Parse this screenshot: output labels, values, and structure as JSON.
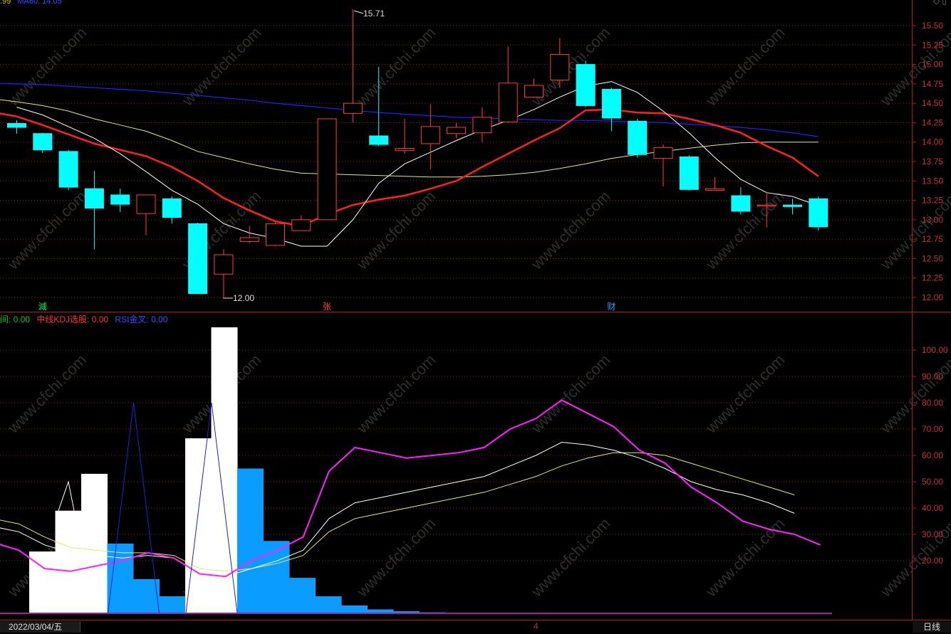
{
  "header": {
    "partial_left": ".99",
    "partial_ma": "MA60: 14.05"
  },
  "indicator_legend": [
    {
      "label": "间: 0.00",
      "color": "#00cc00"
    },
    {
      "label": "中线KDJ选股: 0.00",
      "color": "#ff3030"
    },
    {
      "label": "RSI金叉: 0.00",
      "color": "#3050ff"
    }
  ],
  "footer": {
    "date": "2022/03/04/五",
    "scroll_marker": "4",
    "period": "日线"
  },
  "price_annotations": {
    "high": "15.71",
    "low": "12.00"
  },
  "event_markers": [
    {
      "index": 1,
      "text": "減",
      "color": "#00ff60"
    },
    {
      "index": 12,
      "text": "张",
      "color": "#ff4040"
    },
    {
      "index": 23,
      "text": "财",
      "color": "#30a0ff"
    }
  ],
  "watermark": "www.cfchi.com",
  "colors": {
    "up": "#ff3b3b",
    "down": "#00ffff",
    "axis": "#b01818",
    "ma_white": "#ffffff",
    "ma_red": "#ff2020",
    "ma_yellow": "#e8e870",
    "ma_blue": "#2020ff",
    "bar_white": "#ffffff",
    "bar_blue": "#0a9cff",
    "line_magenta": "#ff20ff",
    "line_signal_blue": "#2020dd"
  },
  "chart_data": [
    {
      "type": "candlestick",
      "ylim": [
        11.9,
        15.75
      ],
      "ticks": [
        "15.50",
        "15.25",
        "15.00",
        "14.75",
        "14.50",
        "14.25",
        "14.00",
        "13.75",
        "13.50",
        "13.25",
        "13.00",
        "12.75",
        "12.50",
        "12.25",
        "12.00"
      ],
      "candles": [
        {
          "o": 14.24,
          "h": 14.28,
          "l": 14.11,
          "c": 14.19
        },
        {
          "o": 14.11,
          "h": 14.12,
          "l": 13.86,
          "c": 13.9
        },
        {
          "o": 13.88,
          "h": 13.9,
          "l": 13.38,
          "c": 13.42
        },
        {
          "o": 13.4,
          "h": 13.63,
          "l": 12.62,
          "c": 13.15
        },
        {
          "o": 13.32,
          "h": 13.4,
          "l": 13.1,
          "c": 13.2
        },
        {
          "o": 13.08,
          "h": 13.32,
          "l": 12.8,
          "c": 13.32
        },
        {
          "o": 13.27,
          "h": 13.3,
          "l": 12.95,
          "c": 13.03
        },
        {
          "o": 12.95,
          "h": 12.96,
          "l": 12.05,
          "c": 12.05
        },
        {
          "o": 12.3,
          "h": 12.62,
          "l": 12.0,
          "c": 12.55
        },
        {
          "o": 12.72,
          "h": 12.92,
          "l": 12.7,
          "c": 12.77
        },
        {
          "o": 12.67,
          "h": 12.97,
          "l": 12.66,
          "c": 12.95
        },
        {
          "o": 12.86,
          "h": 13.06,
          "l": 12.86,
          "c": 13.0
        },
        {
          "o": 13.0,
          "h": 14.3,
          "l": 13.0,
          "c": 14.3
        },
        {
          "o": 14.37,
          "h": 15.71,
          "l": 14.25,
          "c": 14.5
        },
        {
          "o": 14.08,
          "h": 14.97,
          "l": 13.95,
          "c": 13.97
        },
        {
          "o": 13.89,
          "h": 14.3,
          "l": 13.85,
          "c": 13.92
        },
        {
          "o": 13.98,
          "h": 14.49,
          "l": 13.65,
          "c": 14.2
        },
        {
          "o": 14.11,
          "h": 14.25,
          "l": 14.05,
          "c": 14.19
        },
        {
          "o": 14.12,
          "h": 14.45,
          "l": 14.0,
          "c": 14.32
        },
        {
          "o": 14.26,
          "h": 15.23,
          "l": 14.25,
          "c": 14.76
        },
        {
          "o": 14.58,
          "h": 14.82,
          "l": 14.57,
          "c": 14.73
        },
        {
          "o": 14.8,
          "h": 15.34,
          "l": 14.7,
          "c": 15.13
        },
        {
          "o": 15.0,
          "h": 15.05,
          "l": 14.45,
          "c": 14.47
        },
        {
          "o": 14.68,
          "h": 14.7,
          "l": 14.14,
          "c": 14.31
        },
        {
          "o": 14.27,
          "h": 14.3,
          "l": 13.8,
          "c": 13.84
        },
        {
          "o": 13.79,
          "h": 13.97,
          "l": 13.43,
          "c": 13.93
        },
        {
          "o": 13.81,
          "h": 13.83,
          "l": 13.38,
          "c": 13.39
        },
        {
          "o": 13.38,
          "h": 13.55,
          "l": 13.38,
          "c": 13.4
        },
        {
          "o": 13.31,
          "h": 13.42,
          "l": 13.07,
          "c": 13.11
        },
        {
          "o": 13.19,
          "h": 13.36,
          "l": 12.9,
          "c": 13.19
        },
        {
          "o": 13.19,
          "h": 13.27,
          "l": 13.07,
          "c": 13.17
        },
        {
          "o": 13.27,
          "h": 13.3,
          "l": 12.86,
          "c": 12.91
        }
      ],
      "ma": {
        "white": [
          14.45,
          14.35,
          14.2,
          14.05,
          13.85,
          13.62,
          13.38,
          13.2,
          12.95,
          12.83,
          12.76,
          12.66,
          12.66,
          13.0,
          13.47,
          13.72,
          13.87,
          14.02,
          14.16,
          14.28,
          14.42,
          14.58,
          14.72,
          14.78,
          14.64,
          14.4,
          14.12,
          13.8,
          13.52,
          13.35,
          13.3,
          13.18
        ],
        "red": [
          14.39,
          14.33,
          14.22,
          14.1,
          13.98,
          13.9,
          13.82,
          13.68,
          13.5,
          13.28,
          13.12,
          12.98,
          12.92,
          13.07,
          13.19,
          13.26,
          13.31,
          13.4,
          13.5,
          13.68,
          13.85,
          14.02,
          14.18,
          14.41,
          14.42,
          14.38,
          14.37,
          14.3,
          14.22,
          14.12,
          13.95,
          13.8,
          13.56
        ],
        "yellow": [
          14.56,
          14.52,
          14.47,
          14.4,
          14.3,
          14.22,
          14.14,
          14.02,
          13.88,
          13.8,
          13.72,
          13.65,
          13.6,
          13.59,
          13.58,
          13.57,
          13.56,
          13.55,
          13.55,
          13.56,
          13.58,
          13.61,
          13.66,
          13.72,
          13.79,
          13.84,
          13.88,
          13.92,
          13.96,
          13.99,
          14.0,
          14.0,
          14.0
        ],
        "blue": [
          14.76,
          14.75,
          14.74,
          14.72,
          14.7,
          14.68,
          14.66,
          14.63,
          14.6,
          14.57,
          14.54,
          14.5,
          14.47,
          14.44,
          14.41,
          14.38,
          14.36,
          14.34,
          14.32,
          14.31,
          14.3,
          14.29,
          14.28,
          14.28,
          14.27,
          14.26,
          14.25,
          14.23,
          14.21,
          14.19,
          14.16,
          14.12,
          14.07
        ]
      },
      "ma_start": -1
    },
    {
      "type": "bar+line",
      "ylim": [
        0,
        110
      ],
      "ticks": [
        "100.00",
        "90.00",
        "80.00",
        "70.00",
        "60.00",
        "50.00",
        "40.00",
        "30.00",
        "20.00"
      ],
      "bars": [
        {
          "i": 1,
          "v": 23.5,
          "color": "white"
        },
        {
          "i": 2,
          "v": 39,
          "color": "white"
        },
        {
          "i": 3,
          "v": 53,
          "color": "white"
        },
        {
          "i": 4,
          "v": 26.5,
          "color": "blue"
        },
        {
          "i": 5,
          "v": 13,
          "color": "blue"
        },
        {
          "i": 6,
          "v": 6.5,
          "color": "blue"
        },
        {
          "i": 7,
          "v": 66.5,
          "color": "white"
        },
        {
          "i": 8,
          "v": 110,
          "color": "white"
        },
        {
          "i": 9,
          "v": 55,
          "color": "blue"
        },
        {
          "i": 10,
          "v": 27.5,
          "color": "blue"
        },
        {
          "i": 11,
          "v": 13.5,
          "color": "blue"
        },
        {
          "i": 12,
          "v": 6.5,
          "color": "blue"
        },
        {
          "i": 13,
          "v": 3,
          "color": "blue"
        },
        {
          "i": 14,
          "v": 1.5,
          "color": "blue"
        },
        {
          "i": 15,
          "v": 0.8,
          "color": "blue"
        },
        {
          "i": 16,
          "v": 0.4,
          "color": "blue"
        },
        {
          "i": 17,
          "v": 0.2,
          "color": "blue"
        }
      ],
      "lines": {
        "magenta": [
          27,
          24,
          17,
          16,
          18,
          20,
          23,
          21,
          15,
          14,
          20,
          24,
          29,
          54,
          63,
          61,
          59,
          60,
          61,
          63,
          70,
          74,
          81,
          76,
          71,
          62,
          57,
          48,
          42,
          35,
          32,
          30,
          26
        ],
        "white": [
          33,
          31,
          26,
          23,
          22,
          21,
          22,
          21,
          15,
          14,
          17,
          20,
          24,
          36,
          42,
          44,
          46,
          48,
          50,
          52,
          56,
          60,
          65,
          64,
          62,
          59,
          55,
          50,
          47,
          45,
          42,
          38
        ],
        "yellow": [
          36,
          34,
          29,
          25,
          24,
          23,
          23,
          22,
          17,
          16,
          17,
          19,
          22,
          31,
          36,
          38,
          40,
          42,
          44,
          46,
          49,
          52,
          56,
          59,
          61,
          61,
          60,
          57,
          54,
          51,
          48,
          45
        ],
        "blue_signal_peaks": [
          5,
          8
        ]
      }
    }
  ]
}
